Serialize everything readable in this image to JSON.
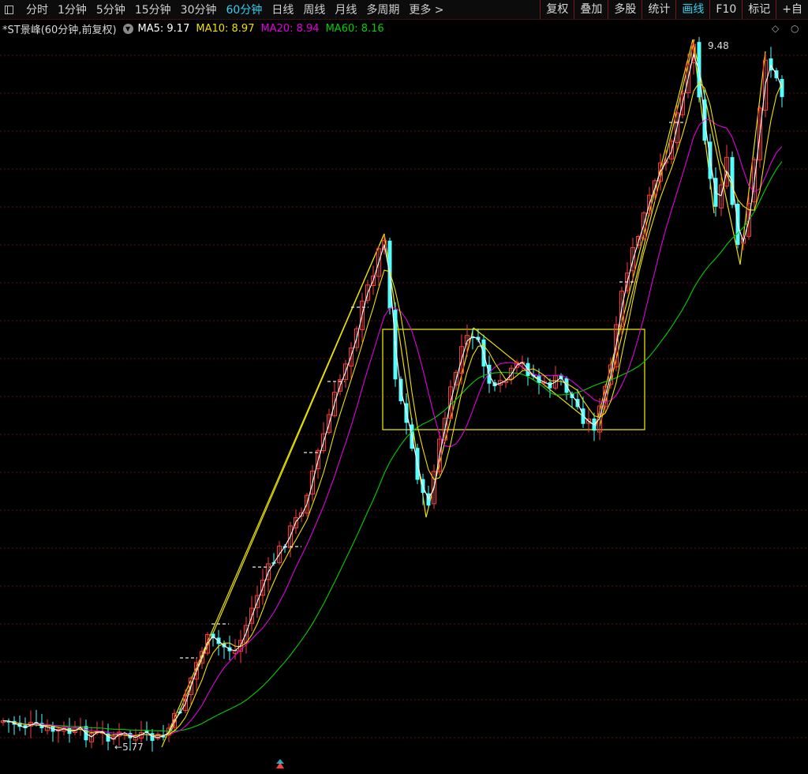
{
  "toolbar": {
    "periods": [
      "分时",
      "1分钟",
      "5分钟",
      "15分钟",
      "30分钟",
      "60分钟",
      "日线",
      "周线",
      "月线",
      "多周期"
    ],
    "active_period": "60分钟",
    "more_label": "更多 >",
    "tools": [
      "复权",
      "叠加",
      "多股",
      "统计",
      "画线",
      "F10",
      "标记",
      "+自"
    ],
    "active_tool": "画线"
  },
  "legend": {
    "stock_title": "*ST景峰(60分钟,前复权)",
    "ma": [
      {
        "label": "MA5: 9.17",
        "color": "#ffffff"
      },
      {
        "label": "MA10: 8.97",
        "color": "#f0e000"
      },
      {
        "label": "MA20: 8.94",
        "color": "#e000e0"
      },
      {
        "label": "MA60: 8.16",
        "color": "#00d000"
      }
    ]
  },
  "chart_data": {
    "type": "candlestick",
    "annotations": {
      "high": "9.48",
      "low": "5.77"
    },
    "ma_colors": {
      "MA5": "#ffffff",
      "MA10": "#f0e000",
      "MA20": "#e000e0",
      "MA60": "#00d000"
    },
    "up_color": "#ff3a3a",
    "down_color": "#54ffff",
    "markers": [
      "up-arrow-marker"
    ]
  }
}
